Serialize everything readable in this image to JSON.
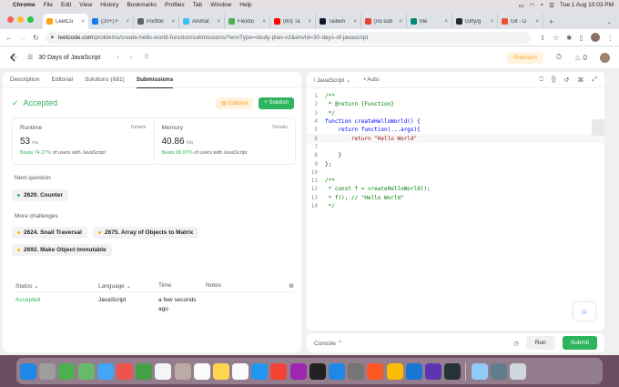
{
  "menubar": {
    "app": "Chrome",
    "items": [
      "File",
      "Edit",
      "View",
      "History",
      "Bookmarks",
      "Profiles",
      "Tab",
      "Window",
      "Help"
    ],
    "datetime": "Tue 1 Aug  10:03 PM"
  },
  "tabs": [
    {
      "label": "LeetCo",
      "color": "#ffa116",
      "active": true
    },
    {
      "label": "(20+) F",
      "color": "#1877f2",
      "active": false
    },
    {
      "label": "Portfoli",
      "color": "#5f6368",
      "active": false
    },
    {
      "label": "Animat",
      "color": "#38bdf8",
      "active": false
    },
    {
      "label": "Flexbo",
      "color": "#4caf50",
      "active": false
    },
    {
      "label": "(80) Ta",
      "color": "#ff0000",
      "active": false
    },
    {
      "label": "Tailwin",
      "color": "#0f172a",
      "active": false
    },
    {
      "label": "(no sub",
      "color": "#ea4335",
      "active": false
    },
    {
      "label": "Me",
      "color": "#00897b",
      "active": false
    },
    {
      "label": "Giffy/g",
      "color": "#24292e",
      "active": false
    },
    {
      "label": "Git - D",
      "color": "#f05032",
      "active": false
    }
  ],
  "address": {
    "host": "leetcode.com",
    "path": "/problems/create-hello-world-function/submissions/?envType=study-plan-v2&envId=30-days-of-javascript"
  },
  "header": {
    "title": "30 Days of JavaScript",
    "premium": "Premium",
    "streak": "0"
  },
  "left_tabs": [
    "Description",
    "Editorial",
    "Solutions (681)",
    "Submissions"
  ],
  "result": {
    "status": "Accepted",
    "editorial_btn": "Editorial",
    "solution_btn": "Solution"
  },
  "runtime": {
    "label": "Runtime",
    "details": "Details",
    "value": "53",
    "unit": "ms",
    "beats_pct": "Beats 74.27%",
    "beats_rest": "of users with JavaScript"
  },
  "memory": {
    "label": "Memory",
    "details": "Details",
    "value": "40.86",
    "unit": "mb",
    "beats_pct": "Beats 99.07%",
    "beats_rest": "of users with JavaScript"
  },
  "next_question": {
    "label": "Next question",
    "item": "2620. Counter",
    "color": "#2db55d"
  },
  "more_challenges": {
    "label": "More challenges",
    "items": [
      {
        "title": "2624. Snail Traversal",
        "color": "#ffb800"
      },
      {
        "title": "2675. Array of Objects to Matrix",
        "color": "#ffb800"
      },
      {
        "title": "2692. Make Object Immutable",
        "color": "#ffb800"
      }
    ]
  },
  "submissions_table": {
    "headers": [
      "Status",
      "Language",
      "Time",
      "Notes"
    ],
    "row": {
      "status": "Accepted",
      "language": "JavaScript",
      "time": "a few seconds ago"
    }
  },
  "editor": {
    "language": "JavaScript",
    "mode": "Auto",
    "lines": [
      {
        "n": "1",
        "text": "/**",
        "cls": "cm"
      },
      {
        "n": "2",
        "text": " * @return {Function}",
        "cls": "cm"
      },
      {
        "n": "3",
        "text": " */",
        "cls": "cm"
      },
      {
        "n": "4",
        "text": "function createHelloWorld() {",
        "cls": "kw"
      },
      {
        "n": "5",
        "text": "    return function(...args){",
        "cls": "kw"
      },
      {
        "n": "6",
        "text": "        return \"Hello World\"",
        "cls": "str"
      },
      {
        "n": "7",
        "text": "",
        "cls": ""
      },
      {
        "n": "8",
        "text": "    }",
        "cls": ""
      },
      {
        "n": "9",
        "text": "};",
        "cls": ""
      },
      {
        "n": "10",
        "text": "",
        "cls": ""
      },
      {
        "n": "11",
        "text": "/**",
        "cls": "cm"
      },
      {
        "n": "12",
        "text": " * const f = createHelloWorld();",
        "cls": "cm"
      },
      {
        "n": "13",
        "text": " * f(); // \"Hello World\"",
        "cls": "cm"
      },
      {
        "n": "14",
        "text": " */",
        "cls": "cm"
      }
    ]
  },
  "console": {
    "label": "Console",
    "run": "Run",
    "submit": "Submit"
  },
  "dock": [
    {
      "name": "finder-icon",
      "color": "#1e88e5"
    },
    {
      "name": "launchpad-icon",
      "color": "#9e9e9e"
    },
    {
      "name": "messages-icon",
      "color": "#4caf50"
    },
    {
      "name": "maps-icon",
      "color": "#66bb6a"
    },
    {
      "name": "mail-icon",
      "color": "#42a5f5"
    },
    {
      "name": "photos-icon",
      "color": "#ef5350"
    },
    {
      "name": "facetime-icon",
      "color": "#43a047"
    },
    {
      "name": "calendar-icon",
      "color": "#f5f5f5"
    },
    {
      "name": "contacts-icon",
      "color": "#bcaaa4"
    },
    {
      "name": "reminders-icon",
      "color": "#fafafa"
    },
    {
      "name": "notes-icon",
      "color": "#ffd54f"
    },
    {
      "name": "freeform-icon",
      "color": "#fafafa"
    },
    {
      "name": "safari-icon",
      "color": "#2196f3"
    },
    {
      "name": "music-icon",
      "color": "#f44336"
    },
    {
      "name": "podcasts-icon",
      "color": "#9c27b0"
    },
    {
      "name": "tv-icon",
      "color": "#212121"
    },
    {
      "name": "appstore-icon",
      "color": "#1e88e5"
    },
    {
      "name": "settings-icon",
      "color": "#757575"
    },
    {
      "name": "brave-icon",
      "color": "#ff5722"
    },
    {
      "name": "chrome-icon",
      "color": "#fbbc05"
    },
    {
      "name": "vscode-icon",
      "color": "#1976d2"
    },
    {
      "name": "slack-icon",
      "color": "#5e35b1"
    },
    {
      "name": "terminal-icon",
      "color": "#263238"
    },
    {
      "name": "preview-icon",
      "color": "#90caf9"
    },
    {
      "name": "downloads-icon",
      "color": "#607d8b"
    },
    {
      "name": "trash-icon",
      "color": "#cfd8dc"
    }
  ]
}
